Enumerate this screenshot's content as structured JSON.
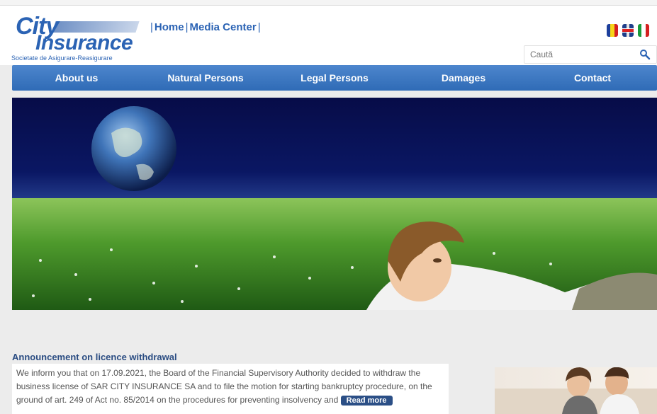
{
  "header": {
    "logo_city": "City",
    "logo_insurance": "Insurance",
    "logo_tagline": "Societate de Asigurare-Reasigurare",
    "top_links": [
      "Home",
      "Media Center"
    ],
    "search_placeholder": "Caută",
    "flags": [
      "ro-flag",
      "uk-flag",
      "it-flag"
    ]
  },
  "nav": {
    "items": [
      "About us",
      "Natural Persons",
      "Legal Persons",
      "Damages",
      "Contact"
    ]
  },
  "announcement": {
    "title": "Announcement on licence withdrawal",
    "text": "We inform you that on 17.09.2021, the Board of the Financial Supervisory Authority decided to withdraw the business license of SAR CITY INSURANCE SA and to file the motion for starting bankruptcy procedure, on the ground of art. 249 of Act no. 85/2014 on the procedures for preventing insolvency and",
    "read_more": "Read more"
  },
  "colors": {
    "brand_blue": "#2b63b4",
    "nav_blue": "#3a75c0",
    "title_blue": "#2a4c82"
  }
}
